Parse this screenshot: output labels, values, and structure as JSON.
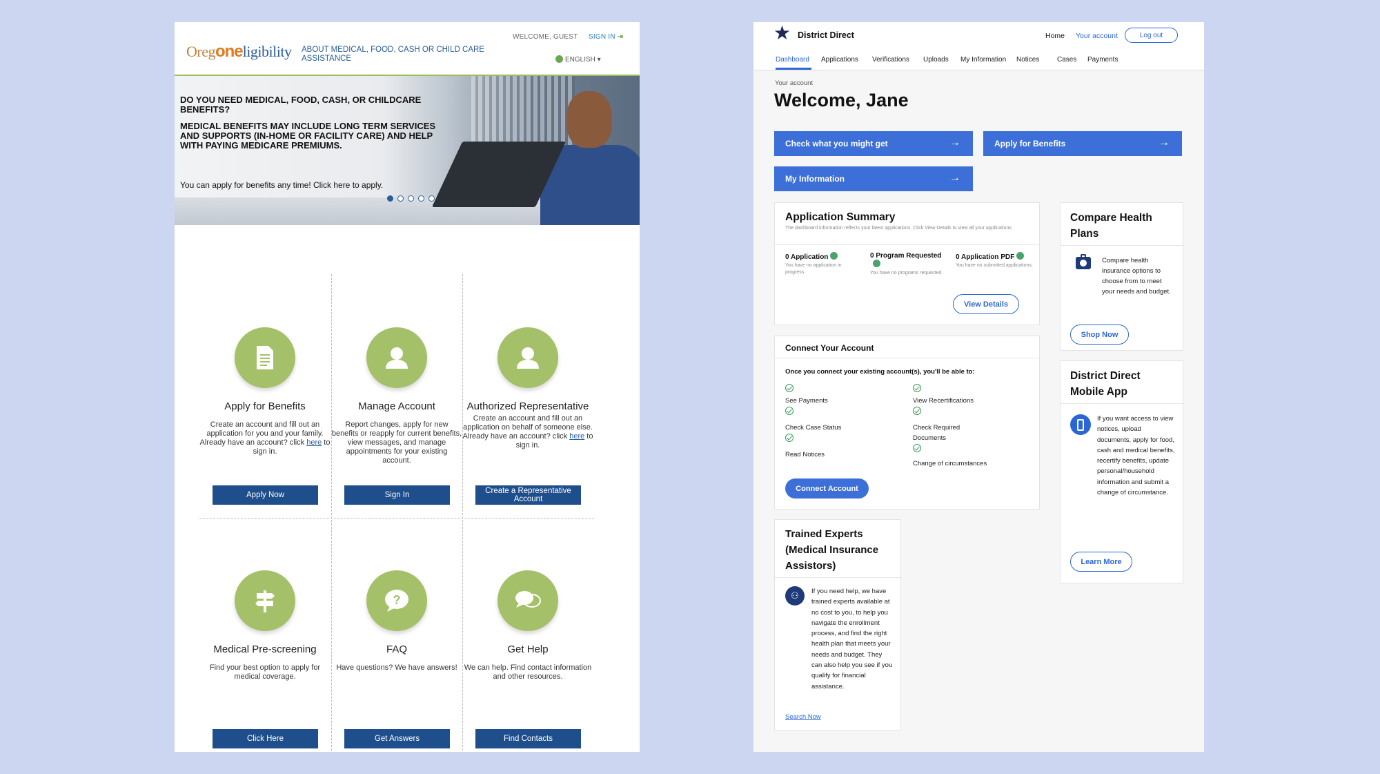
{
  "oregon": {
    "logo": {
      "pre": "Oreg",
      "one": "one",
      "post": "ligibility"
    },
    "tagline": "ABOUT MEDICAL, FOOD, CASH OR CHILD CARE ASSISTANCE",
    "welcome": "WELCOME, GUEST",
    "signin": "SIGN IN",
    "language": "ENGLISH ▾",
    "hero": {
      "heading1": "DO YOU NEED MEDICAL, FOOD, CASH, OR CHILDCARE BENEFITS?",
      "heading2": "MEDICAL BENEFITS MAY INCLUDE LONG TERM SERVICES AND SUPPORTS (IN-HOME OR FACILITY CARE) AND HELP WITH PAYING MEDICARE PREMIUMS.",
      "subtext": "You can apply for benefits any time! Click here to apply."
    },
    "cards": {
      "apply": {
        "title": "Apply for Benefits",
        "desc_a": "Create an account and fill out an application for you and your family.",
        "desc_b": "Already have an account? click ",
        "link": "here",
        "desc_c": " to sign in.",
        "button": "Apply Now"
      },
      "manage": {
        "title": "Manage Account",
        "desc": "Report changes, apply for new benefits or reapply for current benefits, view messages, and manage appointments for your existing account.",
        "button": "Sign In"
      },
      "rep": {
        "title": "Authorized Representative",
        "desc_a": "Create an account and fill out an application on behalf of someone else.",
        "desc_b": "Already have an account? click ",
        "link": "here",
        "desc_c": " to sign in.",
        "button": "Create a Representative Account"
      },
      "prescreen": {
        "title": "Medical Pre-screening",
        "desc": "Find your best option to apply for medical coverage.",
        "button": "Click Here"
      },
      "faq": {
        "title": "FAQ",
        "desc": "Have questions? We have answers!",
        "button": "Get Answers"
      },
      "help": {
        "title": "Get Help",
        "desc": "We can help. Find contact information and other resources.",
        "button": "Find Contacts"
      }
    }
  },
  "district": {
    "brand": "District Direct",
    "nav": {
      "home": "Home",
      "account": "Your account",
      "logout": "Log out"
    },
    "tabs": [
      "Dashboard",
      "Applications",
      "Verifications",
      "Uploads",
      "My Information",
      "Notices",
      "Cases",
      "Payments"
    ],
    "breadcrumb": "Your account",
    "welcome": "Welcome, Jane",
    "cta": {
      "check": "Check what you might get",
      "apply": "Apply for Benefits",
      "info": "My Information"
    },
    "app_summary": {
      "title": "Application Summary",
      "note": "The dashboard information reflects your latest applications. Click View Details to view all your applications.",
      "stats": [
        {
          "label": "0 Application",
          "sub": "You have no application in progress."
        },
        {
          "label": "0 Program Requested",
          "sub": "You have no programs requested."
        },
        {
          "label": "0 Application PDF",
          "sub": "You have no submitted applications."
        }
      ],
      "button": "View Details"
    },
    "connect": {
      "title": "Connect Your Account",
      "intro": "Once you connect your existing account(s), you'll be able to:",
      "items_left": [
        "See Payments",
        "Check Case Status",
        "Read Notices"
      ],
      "items_right": [
        "View Recertifications",
        "Check Required Documents",
        "Change of circumstances"
      ],
      "button": "Connect Account"
    },
    "experts": {
      "title": "Trained Experts (Medical Insurance Assistors)",
      "body": "If you need help, we have trained experts available at no cost to you, to help you navigate the enrollment process, and find the right health plan that meets your needs and budget. They can also help you see if you qualify for financial assistance.",
      "link": "Search Now"
    },
    "compare": {
      "title": "Compare Health Plans",
      "body": "Compare health insurance options to choose from to meet your needs and budget.",
      "button": "Shop Now"
    },
    "mobile": {
      "title": "District Direct Mobile App",
      "body": "If you want access to view notices, upload documents, apply for food, cash and medical benefits, recertify benefits, update personal/household information and submit a change of circumstance.",
      "button": "Learn More"
    }
  }
}
